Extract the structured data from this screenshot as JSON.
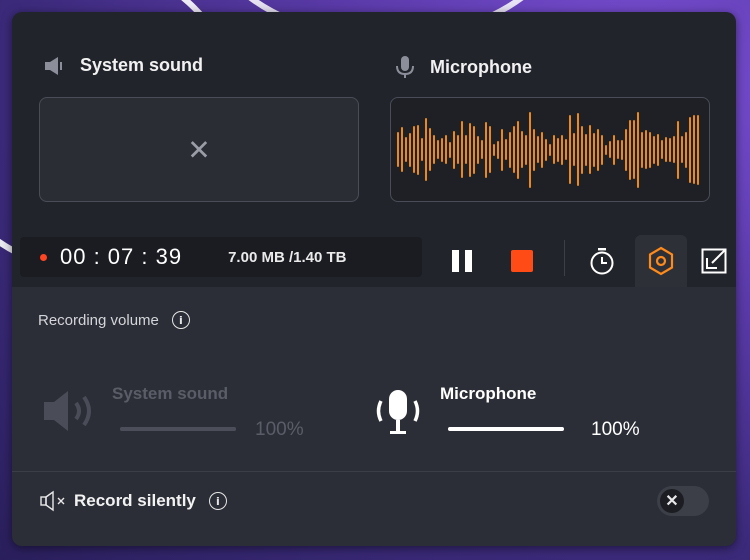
{
  "sources": {
    "system": {
      "label": "System sound",
      "empty_mark": "✕"
    },
    "microphone": {
      "label": "Microphone"
    }
  },
  "status": {
    "timer": "00 : 07 : 39",
    "size": "7.00 MB /1.40 TB"
  },
  "toolbar": {
    "pause_icon": "pause-icon",
    "stop_icon": "stop-icon",
    "timer_icon": "stopwatch-icon",
    "settings_icon": "hexagon-settings-icon",
    "shrink_icon": "shrink-window-icon"
  },
  "settings": {
    "recording_volume_label": "Recording volume",
    "info_glyph": "i",
    "system": {
      "label": "System sound",
      "percent": "100%",
      "level": 1.0,
      "enabled": false
    },
    "microphone": {
      "label": "Microphone",
      "percent": "100%",
      "level": 1.0,
      "enabled": true
    },
    "record_silently_label": "Record silently",
    "toggle_glyph": "✕",
    "toggle_on": false
  },
  "colors": {
    "accent": "#ff4c16",
    "waveform": "#ea8a1a",
    "settings_active": "#ff8a1a"
  }
}
